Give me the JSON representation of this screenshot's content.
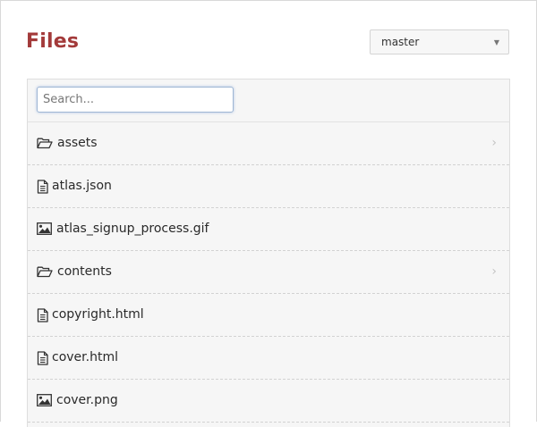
{
  "header": {
    "title": "Files",
    "title_color": "#a33a3a"
  },
  "branch_select": {
    "selected": "master",
    "caret_icon": "caret-down-icon"
  },
  "search": {
    "placeholder": "Search...",
    "value": ""
  },
  "files": [
    {
      "name": "assets",
      "type": "folder",
      "icon": "folder-open-icon",
      "has_chevron": true
    },
    {
      "name": "atlas.json",
      "type": "file",
      "icon": "file-text-icon",
      "has_chevron": false
    },
    {
      "name": "atlas_signup_process.gif",
      "type": "image",
      "icon": "image-icon",
      "has_chevron": false
    },
    {
      "name": "contents",
      "type": "folder",
      "icon": "folder-open-icon",
      "has_chevron": true
    },
    {
      "name": "copyright.html",
      "type": "file",
      "icon": "file-text-icon",
      "has_chevron": false
    },
    {
      "name": "cover.html",
      "type": "file",
      "icon": "file-text-icon",
      "has_chevron": false
    },
    {
      "name": "cover.png",
      "type": "image",
      "icon": "image-icon",
      "has_chevron": false
    }
  ]
}
